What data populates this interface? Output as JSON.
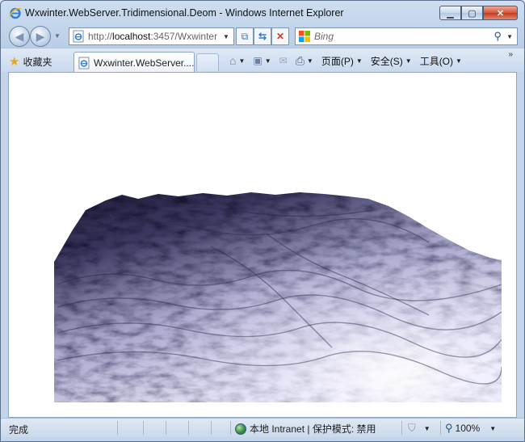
{
  "window": {
    "title": "Wxwinter.WebServer.Tridimensional.Deom - Windows Internet Explorer",
    "minimize_icon": "minimize-icon",
    "maximize_icon": "maximize-icon",
    "close_icon": "close-icon"
  },
  "navigation": {
    "back_icon": "back-arrow-icon",
    "forward_icon": "forward-arrow-icon",
    "address_scheme": "http://",
    "address_host": "localhost",
    "address_rest": ":3457/Wxwinter",
    "search_placeholder": "Bing"
  },
  "favorites": {
    "label": "收藏夹"
  },
  "tab": {
    "label": "Wxwinter.WebServer...."
  },
  "commands": [
    {
      "id": "page",
      "label": "页面(P)"
    },
    {
      "id": "safety",
      "label": "安全(S)"
    },
    {
      "id": "tools",
      "label": "工具(O)"
    }
  ],
  "status": {
    "text": "完成",
    "zone": "本地 Intranet | 保护模式: 禁用",
    "zoom": "100%"
  },
  "colors": {
    "terrain_dark": "#1d1a35",
    "terrain_mid": "#7d7aa6",
    "terrain_light": "#f4f3ff"
  }
}
